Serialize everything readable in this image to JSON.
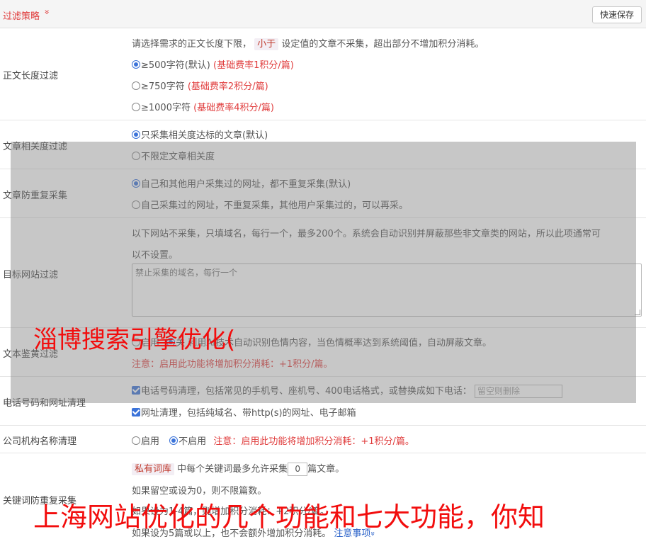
{
  "header": {
    "title": "过滤策略",
    "chevron": "»",
    "save_label": "快速保存"
  },
  "length_filter": {
    "label": "正文长度过滤",
    "desc_prefix": "请选择需求的正文长度下限，",
    "desc_tag": "小于",
    "desc_suffix": "设定值的文章不采集，超出部分不增加积分消耗。",
    "options": [
      {
        "label": "≥500字符(默认)",
        "note": "(基础费率1积分/篇)",
        "checked": true
      },
      {
        "label": "≥750字符",
        "note": "(基础费率2积分/篇)",
        "checked": false
      },
      {
        "label": "≥1000字符",
        "note": "(基础费率4积分/篇)",
        "checked": false
      }
    ]
  },
  "relevance": {
    "label": "文章相关度过滤",
    "options": [
      {
        "label": "只采集相关度达标的文章(默认)",
        "checked": true
      },
      {
        "label": "不限定文章相关度",
        "checked": false
      }
    ]
  },
  "dedup": {
    "label": "文章防重复采集",
    "options": [
      {
        "label": "自己和其他用户采集过的网址，都不重复采集(默认)",
        "checked": true
      },
      {
        "label": "自己采集过的网址，不重复采集，其他用户采集过的，可以再采。",
        "checked": false
      }
    ]
  },
  "site_filter": {
    "label": "目标网站过滤",
    "desc_line1": "以下网站不采集，只填域名，每行一个，最多200个。系统会自动识别并屏蔽那些非文章类的网站，所以此项通常可",
    "desc_line2": "以不设置。",
    "placeholder": "禁止采集的域名，每行一个"
  },
  "text_check": {
    "label": "文本鉴黄过滤",
    "option_on": "启用",
    "option_off": "关",
    "desc": "利用AI技术自动识别色情内容，当色情概率达到系统阈值，自动屏蔽文章。",
    "note": "注意：启用此功能将增加积分消耗：+1积分/篇。"
  },
  "phone_cleanup": {
    "label": "电话号码和网址清理",
    "phone_text": "电话号码清理，包括常见的手机号、座机号、400电话格式，或替换成如下电话：",
    "phone_placeholder": "留空则删除",
    "url_text": "网址清理，包括纯域名、带http(s)的网址、电子邮箱"
  },
  "org_cleanup": {
    "label": "公司机构名称清理",
    "option_on": "启用",
    "option_off": "不启用",
    "note": "注意：启用此功能将增加积分消耗：+1积分/篇。"
  },
  "keyword_dedup": {
    "label": "关键词防重复采集",
    "tag": "私有词库",
    "line1_mid": "中每个关键词最多允许采集",
    "value": "0",
    "line1_end": "篇文章。",
    "line2": "如果留空或设为0，则不限篇数。",
    "line3": "如果设为1-4篇，则增加积分消耗：+2积分/篇。",
    "line4": "如果设为5篇或以上，也不会额外增加积分消耗。",
    "link": "注意事项",
    "link_chev": "»"
  },
  "watermarks": {
    "top": "淄博搜索引擎优化(",
    "bottom": "上海网站优化的几个功能和七大功能，你知"
  }
}
